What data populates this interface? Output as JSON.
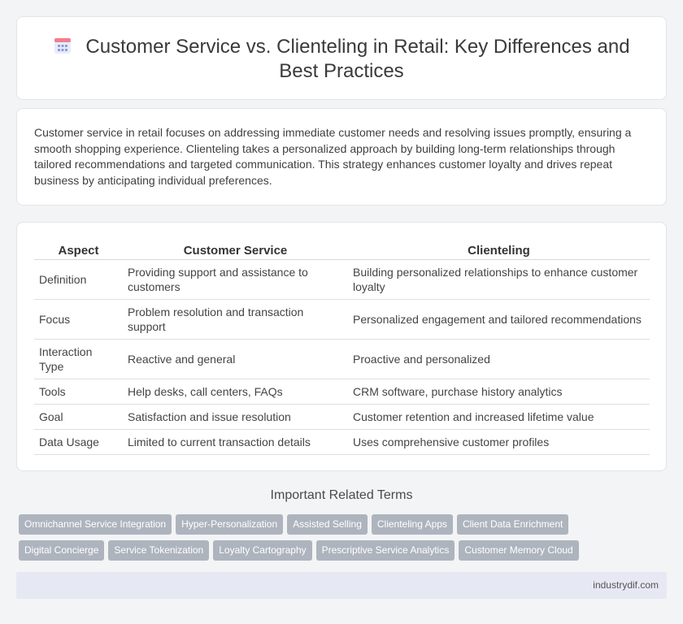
{
  "page": {
    "title": "Customer Service vs. Clienteling in Retail: Key Differences and Best Practices",
    "title_icon": "calendar-icon",
    "intro": "Customer service in retail focuses on addressing immediate customer needs and resolving issues promptly, ensuring a smooth shopping experience. Clienteling takes a personalized approach by building long-term relationships through tailored recommendations and targeted communication. This strategy enhances customer loyalty and drives repeat business by anticipating individual preferences."
  },
  "table": {
    "headers": [
      "Aspect",
      "Customer Service",
      "Clienteling"
    ],
    "rows": [
      [
        "Definition",
        "Providing support and assistance to customers",
        "Building personalized relationships to enhance customer loyalty"
      ],
      [
        "Focus",
        "Problem resolution and transaction support",
        "Personalized engagement and tailored recommendations"
      ],
      [
        "Interaction Type",
        "Reactive and general",
        "Proactive and personalized"
      ],
      [
        "Tools",
        "Help desks, call centers, FAQs",
        "CRM software, purchase history analytics"
      ],
      [
        "Goal",
        "Satisfaction and issue resolution",
        "Customer retention and increased lifetime value"
      ],
      [
        "Data Usage",
        "Limited to current transaction details",
        "Uses comprehensive customer profiles"
      ]
    ]
  },
  "related": {
    "title": "Important Related Terms",
    "terms": [
      "Omnichannel Service Integration",
      "Hyper-Personalization",
      "Assisted Selling",
      "Clienteling Apps",
      "Client Data Enrichment",
      "Digital Concierge",
      "Service Tokenization",
      "Loyalty Cartography",
      "Prescriptive Service Analytics",
      "Customer Memory Cloud"
    ]
  },
  "footer": {
    "site": "industrydif.com"
  },
  "colors": {
    "tag_bg": "#aeb4be",
    "footer_bg": "#e6e9f3",
    "page_bg": "#f3f4f6"
  }
}
